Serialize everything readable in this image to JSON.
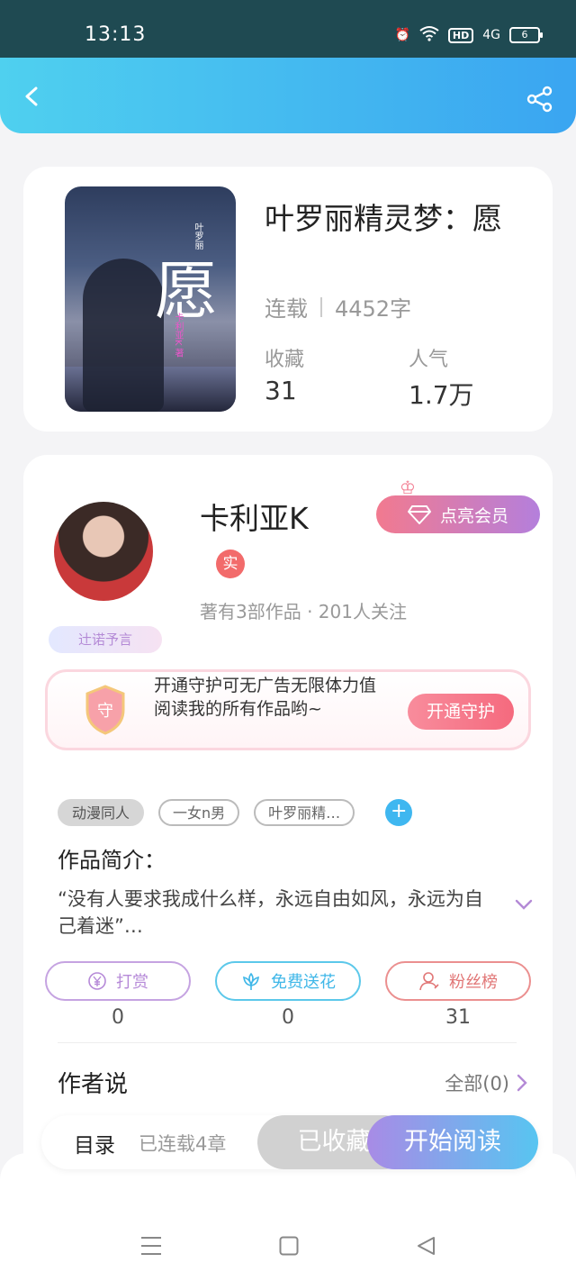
{
  "status_bar": {
    "time": "13:13",
    "network": "4G",
    "hd": "HD",
    "battery": "6"
  },
  "header": {
    "back_icon": "chevron-left-icon",
    "share_icon": "share-icon",
    "gradient": [
      "#4fd0ef",
      "#3aa5f1"
    ]
  },
  "book": {
    "title": "叶罗丽精灵梦：愿",
    "status": "连载",
    "word_count": "4452字",
    "stats": [
      {
        "label": "收藏",
        "value": "31"
      },
      {
        "label": "人气",
        "value": "1.7万"
      }
    ],
    "cover": {
      "main_char": "愿",
      "series_text": "叶罗丽",
      "author_text": "卡利亚K 著"
    }
  },
  "author": {
    "name": "卡利亚K",
    "verified_badge": "实",
    "stats_text": "著有3部作品 · 201人关注",
    "fan_badge": "辻诺予言",
    "vip_button": "点亮会员",
    "guard": {
      "text": "开通守护可无广告无限体力值阅读我的所有作品哟~",
      "shield_char": "守",
      "button": "开通守护"
    }
  },
  "tags": [
    "动漫同人",
    "一女n男",
    "叶罗丽精…"
  ],
  "intro": {
    "label": "作品简介：",
    "text": "“没有人要求我成什么样，永远自由如风，永远为自己着迷”…"
  },
  "actions": [
    {
      "label": "打赏",
      "icon": "yen-icon",
      "count": "0"
    },
    {
      "label": "免费送花",
      "icon": "flower-icon",
      "count": "0"
    },
    {
      "label": "粉丝榜",
      "icon": "user-icon",
      "count": "31"
    }
  ],
  "author_says": {
    "label": "作者说",
    "all_link": "全部(0)"
  },
  "read_bar": {
    "toc": "目录",
    "serial": "已连载4章",
    "collected": "已收藏",
    "start": "开始阅读"
  },
  "colors": {
    "accent_pink": "#f27a8f",
    "accent_purple": "#b47fdc",
    "accent_blue": "#3fb7f0"
  }
}
